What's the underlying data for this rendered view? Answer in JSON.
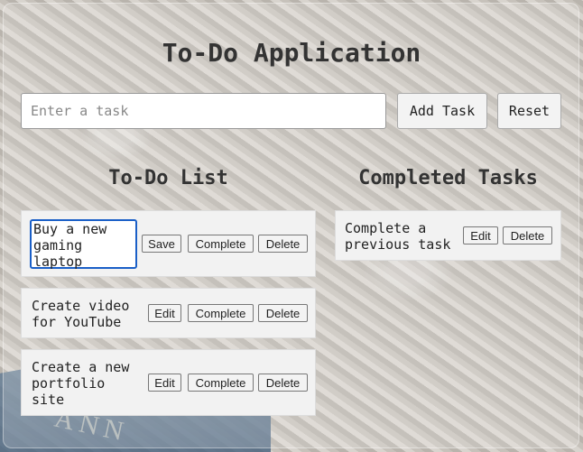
{
  "app": {
    "title": "To-Do Application",
    "input_placeholder": "Enter a task",
    "add_label": "Add Task",
    "reset_label": "Reset"
  },
  "todo": {
    "heading": "To-Do List",
    "items": [
      {
        "text": "Buy a new\ngaming\nlaptop",
        "edit_label": "Save",
        "complete_label": "Complete",
        "delete_label": "Delete",
        "editing": true
      },
      {
        "text": "Create video\nfor YouTube",
        "edit_label": "Edit",
        "complete_label": "Complete",
        "delete_label": "Delete",
        "editing": false
      },
      {
        "text": "Create a new\nportfolio\nsite",
        "edit_label": "Edit",
        "complete_label": "Complete",
        "delete_label": "Delete",
        "editing": false
      }
    ]
  },
  "completed": {
    "heading": "Completed Tasks",
    "items": [
      {
        "text": "Complete a\nprevious task",
        "edit_label": "Edit",
        "delete_label": "Delete"
      }
    ]
  },
  "background": {
    "decorative_text": "ANN"
  }
}
